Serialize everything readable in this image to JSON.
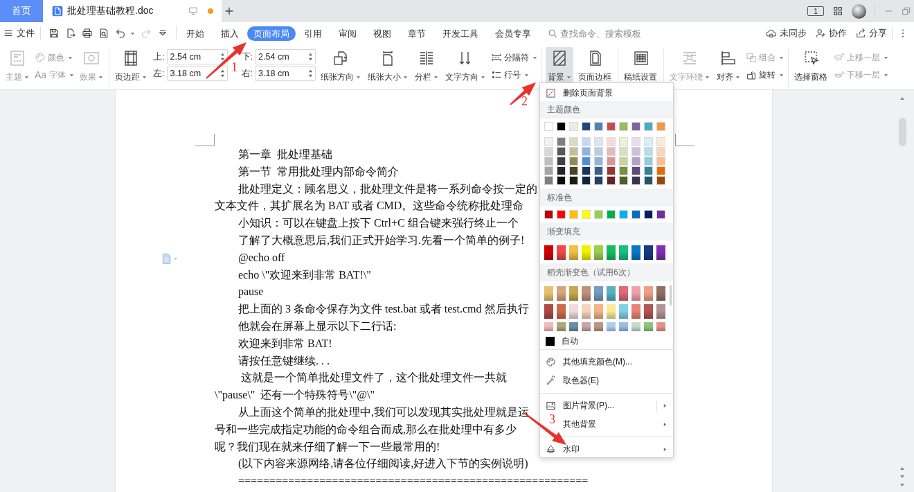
{
  "tab_bar": {
    "tabs": [
      {
        "kind": "home",
        "label": "首页",
        "selected": false
      },
      {
        "kind": "document",
        "label": "批处理基础教程.doc",
        "selected": true,
        "unsaved": true
      }
    ],
    "window_count": "1"
  },
  "menu_bar": {
    "file_label": "文件",
    "quick_access": [
      {
        "disabled": false
      },
      {
        "disabled": false
      },
      {
        "disabled": false
      },
      {
        "disabled": false
      },
      {
        "disabled": false
      },
      {
        "disabled": true
      }
    ],
    "tabs": [
      {
        "label": "开始",
        "selected": false
      },
      {
        "label": "插入",
        "selected": false
      },
      {
        "label": "页面布局",
        "selected": true
      },
      {
        "label": "引用",
        "selected": false
      },
      {
        "label": "审阅",
        "selected": false
      },
      {
        "label": "视图",
        "selected": false
      },
      {
        "label": "章节",
        "selected": false
      },
      {
        "label": "开发工具",
        "selected": false
      },
      {
        "label": "会员专享",
        "selected": false
      }
    ],
    "search": {
      "placeholder": "查找命令、搜索模板"
    },
    "actions": [
      {
        "label": "未同步"
      },
      {
        "label": "协作"
      },
      {
        "label": "分享"
      }
    ]
  },
  "ribbon": {
    "groups": [
      [
        {
          "kind": "large",
          "label": "主题",
          "dropdown": true,
          "disabled": true,
          "open": false
        },
        {
          "kind": "stack",
          "items": [
            {
              "label": "颜色",
              "dropdown": true,
              "disabled": true
            },
            {
              "prefix": "Aa",
              "label": "字体",
              "dropdown": true,
              "disabled": true
            }
          ]
        },
        {
          "kind": "large",
          "label": "效果",
          "dropdown": true,
          "disabled": true,
          "open": false
        }
      ],
      [
        {
          "kind": "large",
          "label": "页边距",
          "dropdown": true,
          "disabled": false,
          "open": false
        },
        {
          "kind": "fields",
          "items": [
            {
              "label": "上:",
              "value": "2.54 cm"
            },
            {
              "label": "下:",
              "value": "2.54 cm"
            },
            {
              "label": "左:",
              "value": "3.18 cm"
            },
            {
              "label": "右:",
              "value": "3.18 cm"
            }
          ]
        },
        {
          "kind": "large",
          "label": "纸张方向",
          "dropdown": true,
          "disabled": false,
          "open": false
        },
        {
          "kind": "large",
          "label": "纸张大小",
          "dropdown": true,
          "disabled": false,
          "open": false
        },
        {
          "kind": "large",
          "label": "分栏",
          "dropdown": true,
          "disabled": false,
          "open": false
        },
        {
          "kind": "large",
          "label": "文字方向",
          "dropdown": true,
          "disabled": false,
          "open": false
        },
        {
          "kind": "stack",
          "items": [
            {
              "label": "分隔符",
              "dropdown": true,
              "disabled": false
            },
            {
              "label": "行号",
              "dropdown": true,
              "disabled": false
            }
          ]
        }
      ],
      [
        {
          "kind": "large",
          "label": "背景",
          "dropdown": true,
          "disabled": false,
          "open": true
        },
        {
          "kind": "large",
          "label": "页面边框",
          "dropdown": false,
          "disabled": false,
          "open": false
        }
      ],
      [
        {
          "kind": "large",
          "label": "稿纸设置",
          "dropdown": false,
          "disabled": false,
          "open": false
        }
      ],
      [
        {
          "kind": "large",
          "label": "文字环绕",
          "dropdown": true,
          "disabled": true,
          "open": false
        },
        {
          "kind": "large",
          "label": "对齐",
          "dropdown": true,
          "disabled": false,
          "open": false
        },
        {
          "kind": "stack",
          "items": [
            {
              "label": "组合",
              "dropdown": true,
              "disabled": true
            },
            {
              "label": "旋转",
              "dropdown": true,
              "disabled": false
            }
          ]
        }
      ],
      [
        {
          "kind": "large",
          "label": "选择窗格",
          "dropdown": false,
          "disabled": false,
          "open": false
        },
        {
          "kind": "stack",
          "items": [
            {
              "label": "上移一层",
              "dropdown": true,
              "disabled": true
            },
            {
              "label": "下移一层",
              "dropdown": true,
              "disabled": true
            }
          ]
        }
      ]
    ]
  },
  "document": {
    "paragraphs": [
      {
        "lines": [
          "第一章  批处理基础"
        ]
      },
      {
        "lines": [
          "第一节  常用批处理内部命令简介"
        ]
      },
      {
        "lines": [
          "批处理定义：顾名思义，批处理文件是将一系列命令按一定的",
          "文本文件，其扩展名为 BAT 或者 CMD。这些命令统称批处理命"
        ]
      },
      {
        "lines": [
          "小知识：可以在键盘上按下 Ctrl+C 组合键来强行终止一个"
        ]
      },
      {
        "lines": [
          "了解了大概意思后,我们正式开始学习.先看一个简单的例子!"
        ]
      },
      {
        "lines": [
          "@echo off"
        ]
      },
      {
        "lines": [
          "echo \\\"欢迎来到非常 BAT!\\\""
        ]
      },
      {
        "lines": [
          "pause"
        ]
      },
      {
        "lines": [
          "把上面的 3 条命令保存为文件 test.bat 或者 test.cmd 然后执行"
        ]
      },
      {
        "lines": [
          "他就会在屏幕上显示以下二行话:"
        ]
      },
      {
        "lines": [
          "欢迎来到非常 BAT!"
        ]
      },
      {
        "lines": [
          "请按任意键继续. . ."
        ]
      },
      {
        "lines": [
          " 这就是一个简单批处理文件了，这个批处理文件一共就",
          "\\\"pause\\\"  还有一个特殊符号\\\"@\\\""
        ]
      },
      {
        "lines": [
          "从上面这个简单的批处理中,我们可以发现其实批处理就是运",
          "号和一些完成指定功能的命令组合而成,那么在批处理中有多少",
          "呢？我们现在就来仔细了解一下一些最常用的!"
        ]
      },
      {
        "lines": [
          "(以下内容来源网络,请各位仔细阅读,好进入下节的实例说明)"
        ]
      },
      {
        "lines": [
          "========================================================"
        ]
      }
    ]
  },
  "background_menu": {
    "remove": {
      "label": "删除页面背景"
    },
    "theme_colors": {
      "title": "主题颜色",
      "base": [
        {
          "color": "#ffffff"
        },
        {
          "color": "#000000"
        },
        {
          "color": "#eeece1"
        },
        {
          "color": "#1f497d"
        },
        {
          "color": "#4f81bd"
        },
        {
          "color": "#c0504d"
        },
        {
          "color": "#9bbb59"
        },
        {
          "color": "#8064a2"
        },
        {
          "color": "#4bacc6"
        },
        {
          "color": "#f79646"
        }
      ],
      "tints": [
        [
          {
            "color": "#f2f2f2"
          },
          {
            "color": "#7f7f7f"
          },
          {
            "color": "#ddd9c3"
          },
          {
            "color": "#c6d9f0"
          },
          {
            "color": "#dbe5f1"
          },
          {
            "color": "#f2dcdb"
          },
          {
            "color": "#ebf1dd"
          },
          {
            "color": "#e5e0ec"
          },
          {
            "color": "#dbeef3"
          },
          {
            "color": "#fdeada"
          }
        ],
        [
          {
            "color": "#d8d8d8"
          },
          {
            "color": "#595959"
          },
          {
            "color": "#c4bd97"
          },
          {
            "color": "#8db3e2"
          },
          {
            "color": "#b8cce4"
          },
          {
            "color": "#e5b9b7"
          },
          {
            "color": "#d7e3bc"
          },
          {
            "color": "#ccc1d9"
          },
          {
            "color": "#b7dde8"
          },
          {
            "color": "#fbd5b5"
          }
        ],
        [
          {
            "color": "#bfbfbf"
          },
          {
            "color": "#3f3f3f"
          },
          {
            "color": "#938953"
          },
          {
            "color": "#548dd4"
          },
          {
            "color": "#95b3d7"
          },
          {
            "color": "#d99694"
          },
          {
            "color": "#c3d69b"
          },
          {
            "color": "#b2a2c7"
          },
          {
            "color": "#92cddc"
          },
          {
            "color": "#fac08f"
          }
        ],
        [
          {
            "color": "#a5a5a5"
          },
          {
            "color": "#262626"
          },
          {
            "color": "#494429"
          },
          {
            "color": "#17365d"
          },
          {
            "color": "#366092"
          },
          {
            "color": "#953734"
          },
          {
            "color": "#76923c"
          },
          {
            "color": "#5f497a"
          },
          {
            "color": "#31859b"
          },
          {
            "color": "#e36c09"
          }
        ],
        [
          {
            "color": "#7f7f7f"
          },
          {
            "color": "#0c0c0c"
          },
          {
            "color": "#1d1b10"
          },
          {
            "color": "#0f243e"
          },
          {
            "color": "#244061"
          },
          {
            "color": "#632423"
          },
          {
            "color": "#4f6128"
          },
          {
            "color": "#3f3151"
          },
          {
            "color": "#205867"
          },
          {
            "color": "#974806"
          }
        ]
      ]
    },
    "standard_colors": {
      "title": "标准色",
      "swatches": [
        {
          "color": "#c00000"
        },
        {
          "color": "#ff0000"
        },
        {
          "color": "#ffc000"
        },
        {
          "color": "#ffff00"
        },
        {
          "color": "#92d050"
        },
        {
          "color": "#00b050"
        },
        {
          "color": "#00b0f0"
        },
        {
          "color": "#0070c0"
        },
        {
          "color": "#002060"
        },
        {
          "color": "#7030a0"
        }
      ]
    },
    "gradient_fill": {
      "title": "渐变填充",
      "swatches": [
        {
          "color": "#d40000"
        },
        {
          "color": "#f04848"
        },
        {
          "color": "#f0c040"
        },
        {
          "color": "#f4f000"
        },
        {
          "color": "#98d050"
        },
        {
          "color": "#10c060"
        },
        {
          "color": "#18c080"
        },
        {
          "color": "#0878c8"
        },
        {
          "color": "#183888"
        },
        {
          "color": "#8030b0"
        }
      ]
    },
    "docer_gradients": {
      "title": "稻壳渐变色（试用6次）",
      "rows": [
        [
          {
            "color": "#e8c070"
          },
          {
            "color": "#d8a478"
          },
          {
            "color": "#c8a848"
          },
          {
            "color": "#c09078"
          },
          {
            "color": "#7898c8"
          },
          {
            "color": "#58b0c0"
          },
          {
            "color": "#e06878"
          },
          {
            "color": "#f0a0a8"
          },
          {
            "color": "#f0a088"
          },
          {
            "color": "#907060"
          }
        ],
        [
          {
            "color": "#b04848"
          },
          {
            "color": "#d06848"
          },
          {
            "color": "#f0dcdc"
          },
          {
            "color": "#f8d4bc"
          },
          {
            "color": "#f4b484"
          },
          {
            "color": "#f8ec98"
          },
          {
            "color": "#80d0e8"
          },
          {
            "color": "#e88474"
          },
          {
            "color": "#b45454"
          },
          {
            "color": "#b09494"
          }
        ],
        [
          {
            "color": "#f4b8b8"
          },
          {
            "color": "#aca878"
          },
          {
            "color": "#6890a8"
          },
          {
            "color": "#c8a4ac"
          },
          {
            "color": "#bc9884"
          },
          {
            "color": "#a8d0ec"
          },
          {
            "color": "#98bcec"
          },
          {
            "color": "#c4dccc"
          },
          {
            "color": "#88c878"
          },
          {
            "color": "#e49484"
          }
        ]
      ]
    },
    "auto": {
      "label": "自动",
      "color": "#000000"
    },
    "item_groups": [
      [
        {
          "label": "其他填充颜色(M)...",
          "submenu": false,
          "split": false
        },
        {
          "label": "取色器(E)",
          "submenu": false,
          "split": false
        }
      ],
      [
        {
          "label": "图片背景(P)...",
          "submenu": true,
          "split": true
        },
        {
          "label": "其他背景",
          "submenu": true,
          "split": false
        }
      ],
      [
        {
          "label": "水印",
          "submenu": true,
          "split": false
        }
      ]
    ]
  },
  "annotations": [
    {
      "label": "1"
    },
    {
      "label": "2"
    },
    {
      "label": "3"
    }
  ]
}
